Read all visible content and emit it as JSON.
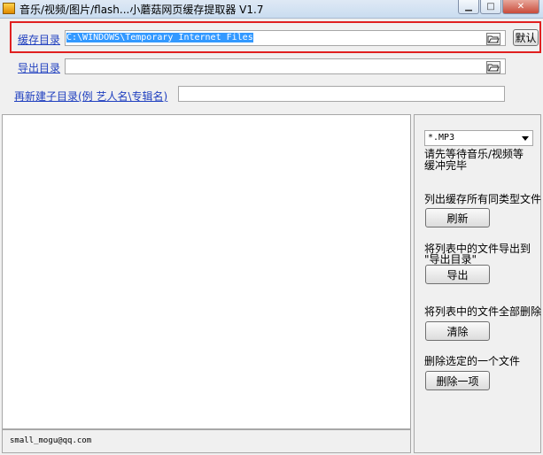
{
  "window": {
    "title": "音乐/视频/图片/flash...小蘑菇网页缓存提取器 V1.7"
  },
  "cache_dir": {
    "label": "缓存目录",
    "value": "C:\\WINDOWS\\Temporary Internet Files",
    "default_button": "默认"
  },
  "export_dir": {
    "label": "导出目录",
    "value": ""
  },
  "subdir": {
    "label": "再新建子目录(例 艺人名\\专辑名)",
    "value": ""
  },
  "right": {
    "filetype_selected": "*.MP3",
    "wait_note_1": "请先等待音乐/视频等",
    "wait_note_2": "缓冲完毕",
    "list_desc": "列出缓存所有同类型文件",
    "refresh_button": "刷新",
    "export_desc_1": "将列表中的文件导出到",
    "export_desc_2": "\"导出目录\"",
    "export_button": "导出",
    "clear_desc": "将列表中的文件全部删除",
    "clear_button": "清除",
    "delete_desc": "删除选定的一个文件",
    "delete_button": "删除一项"
  },
  "status": {
    "email": "small_mogu@qq.com"
  }
}
